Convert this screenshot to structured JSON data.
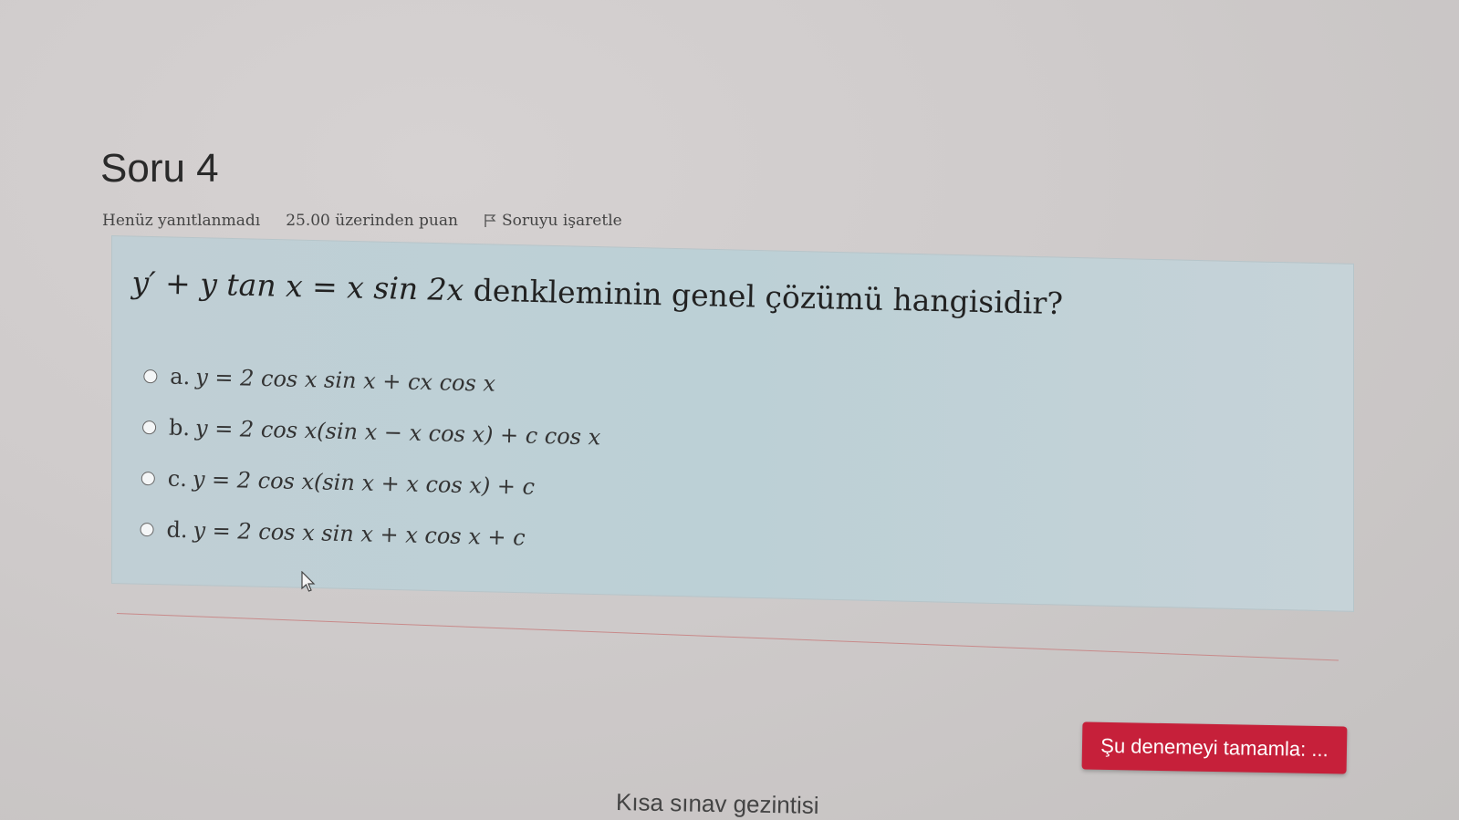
{
  "question": {
    "title": "Soru 4",
    "status": "Henüz yanıtlanmadı",
    "points": "25.00 üzerinden puan",
    "flag_label": "Soruyu işaretle",
    "text_math": "y′ + y tan x = x sin 2x",
    "text_plain": " denkleminin genel çözümü hangisidir?"
  },
  "options": [
    {
      "letter": "a.",
      "math": "y = 2 cos x sin x + cx cos x"
    },
    {
      "letter": "b.",
      "math": "y = 2 cos x(sin x − x cos x) + c cos x"
    },
    {
      "letter": "c.",
      "math": "y = 2 cos x(sin x + x cos x) + c"
    },
    {
      "letter": "d.",
      "math": "y = 2 cos x sin x + x cos x + c"
    }
  ],
  "footer": {
    "finish_label": "Şu denemeyi tamamla: ...",
    "nav_title": "Kısa sınav gezintisi"
  },
  "colors": {
    "accent": "#c6203a",
    "question_bg": "#bcd0d6"
  },
  "icons": {
    "flag": "flag-icon",
    "cursor": "mouse-pointer-icon"
  }
}
